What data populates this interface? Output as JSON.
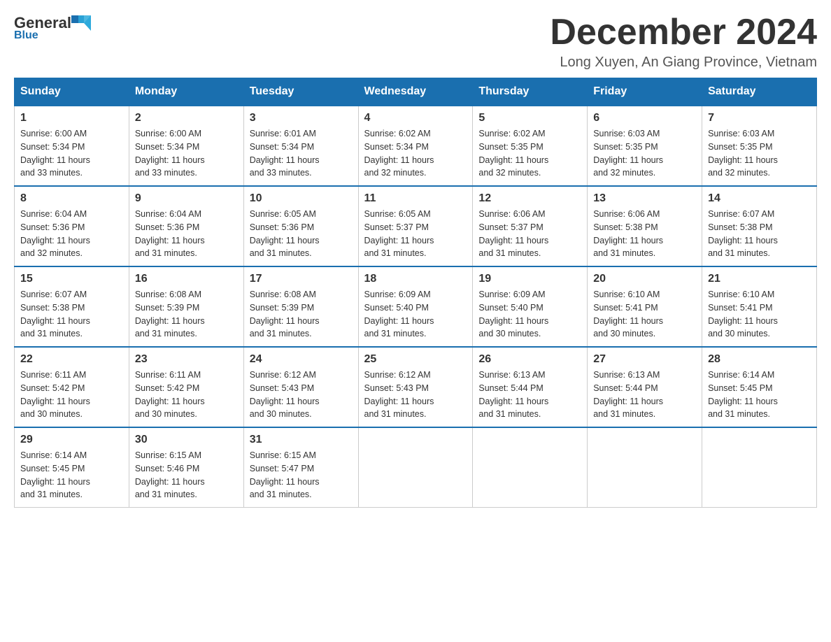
{
  "logo": {
    "general": "General",
    "blue": "Blue",
    "subtitle": "Blue"
  },
  "title": {
    "month_year": "December 2024",
    "location": "Long Xuyen, An Giang Province, Vietnam"
  },
  "weekdays": [
    "Sunday",
    "Monday",
    "Tuesday",
    "Wednesday",
    "Thursday",
    "Friday",
    "Saturday"
  ],
  "weeks": [
    [
      {
        "day": "1",
        "sunrise": "6:00 AM",
        "sunset": "5:34 PM",
        "daylight": "11 hours and 33 minutes."
      },
      {
        "day": "2",
        "sunrise": "6:00 AM",
        "sunset": "5:34 PM",
        "daylight": "11 hours and 33 minutes."
      },
      {
        "day": "3",
        "sunrise": "6:01 AM",
        "sunset": "5:34 PM",
        "daylight": "11 hours and 33 minutes."
      },
      {
        "day": "4",
        "sunrise": "6:02 AM",
        "sunset": "5:34 PM",
        "daylight": "11 hours and 32 minutes."
      },
      {
        "day": "5",
        "sunrise": "6:02 AM",
        "sunset": "5:35 PM",
        "daylight": "11 hours and 32 minutes."
      },
      {
        "day": "6",
        "sunrise": "6:03 AM",
        "sunset": "5:35 PM",
        "daylight": "11 hours and 32 minutes."
      },
      {
        "day": "7",
        "sunrise": "6:03 AM",
        "sunset": "5:35 PM",
        "daylight": "11 hours and 32 minutes."
      }
    ],
    [
      {
        "day": "8",
        "sunrise": "6:04 AM",
        "sunset": "5:36 PM",
        "daylight": "11 hours and 32 minutes."
      },
      {
        "day": "9",
        "sunrise": "6:04 AM",
        "sunset": "5:36 PM",
        "daylight": "11 hours and 31 minutes."
      },
      {
        "day": "10",
        "sunrise": "6:05 AM",
        "sunset": "5:36 PM",
        "daylight": "11 hours and 31 minutes."
      },
      {
        "day": "11",
        "sunrise": "6:05 AM",
        "sunset": "5:37 PM",
        "daylight": "11 hours and 31 minutes."
      },
      {
        "day": "12",
        "sunrise": "6:06 AM",
        "sunset": "5:37 PM",
        "daylight": "11 hours and 31 minutes."
      },
      {
        "day": "13",
        "sunrise": "6:06 AM",
        "sunset": "5:38 PM",
        "daylight": "11 hours and 31 minutes."
      },
      {
        "day": "14",
        "sunrise": "6:07 AM",
        "sunset": "5:38 PM",
        "daylight": "11 hours and 31 minutes."
      }
    ],
    [
      {
        "day": "15",
        "sunrise": "6:07 AM",
        "sunset": "5:38 PM",
        "daylight": "11 hours and 31 minutes."
      },
      {
        "day": "16",
        "sunrise": "6:08 AM",
        "sunset": "5:39 PM",
        "daylight": "11 hours and 31 minutes."
      },
      {
        "day": "17",
        "sunrise": "6:08 AM",
        "sunset": "5:39 PM",
        "daylight": "11 hours and 31 minutes."
      },
      {
        "day": "18",
        "sunrise": "6:09 AM",
        "sunset": "5:40 PM",
        "daylight": "11 hours and 31 minutes."
      },
      {
        "day": "19",
        "sunrise": "6:09 AM",
        "sunset": "5:40 PM",
        "daylight": "11 hours and 30 minutes."
      },
      {
        "day": "20",
        "sunrise": "6:10 AM",
        "sunset": "5:41 PM",
        "daylight": "11 hours and 30 minutes."
      },
      {
        "day": "21",
        "sunrise": "6:10 AM",
        "sunset": "5:41 PM",
        "daylight": "11 hours and 30 minutes."
      }
    ],
    [
      {
        "day": "22",
        "sunrise": "6:11 AM",
        "sunset": "5:42 PM",
        "daylight": "11 hours and 30 minutes."
      },
      {
        "day": "23",
        "sunrise": "6:11 AM",
        "sunset": "5:42 PM",
        "daylight": "11 hours and 30 minutes."
      },
      {
        "day": "24",
        "sunrise": "6:12 AM",
        "sunset": "5:43 PM",
        "daylight": "11 hours and 30 minutes."
      },
      {
        "day": "25",
        "sunrise": "6:12 AM",
        "sunset": "5:43 PM",
        "daylight": "11 hours and 31 minutes."
      },
      {
        "day": "26",
        "sunrise": "6:13 AM",
        "sunset": "5:44 PM",
        "daylight": "11 hours and 31 minutes."
      },
      {
        "day": "27",
        "sunrise": "6:13 AM",
        "sunset": "5:44 PM",
        "daylight": "11 hours and 31 minutes."
      },
      {
        "day": "28",
        "sunrise": "6:14 AM",
        "sunset": "5:45 PM",
        "daylight": "11 hours and 31 minutes."
      }
    ],
    [
      {
        "day": "29",
        "sunrise": "6:14 AM",
        "sunset": "5:45 PM",
        "daylight": "11 hours and 31 minutes."
      },
      {
        "day": "30",
        "sunrise": "6:15 AM",
        "sunset": "5:46 PM",
        "daylight": "11 hours and 31 minutes."
      },
      {
        "day": "31",
        "sunrise": "6:15 AM",
        "sunset": "5:47 PM",
        "daylight": "11 hours and 31 minutes."
      },
      null,
      null,
      null,
      null
    ]
  ],
  "labels": {
    "sunrise": "Sunrise:",
    "sunset": "Sunset:",
    "daylight": "Daylight:"
  }
}
